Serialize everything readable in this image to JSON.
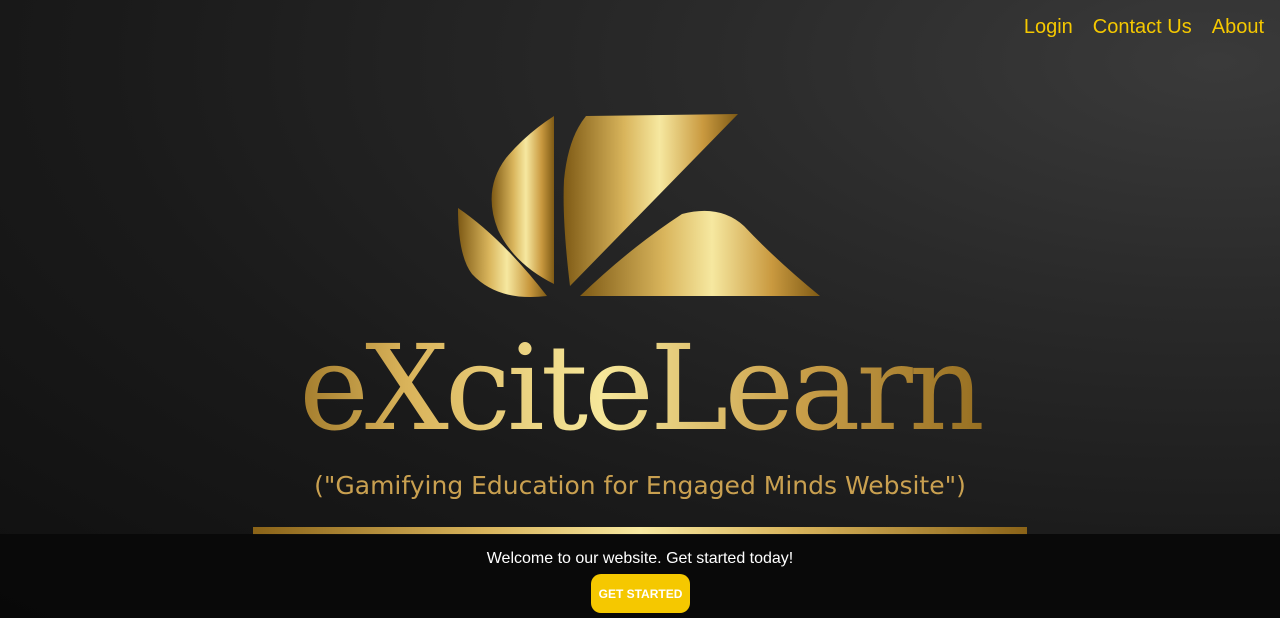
{
  "nav": {
    "items": [
      {
        "label": "Login"
      },
      {
        "label": "Contact Us"
      },
      {
        "label": "About"
      }
    ],
    "color": "#f5c800"
  },
  "brand": {
    "name": "eXciteLearn",
    "tagline": "(\"Gamifying Education for Engaged Minds Website\")",
    "logo_icon": "gold-leaf-k-icon",
    "colors": {
      "gold_dark": "#8a6318",
      "gold_mid": "#d8b45c",
      "gold_light": "#f7e8a0"
    }
  },
  "cta": {
    "message": "Welcome to our website. Get started today!",
    "button_label": "GET STARTED",
    "button_color": "#f5c800"
  }
}
